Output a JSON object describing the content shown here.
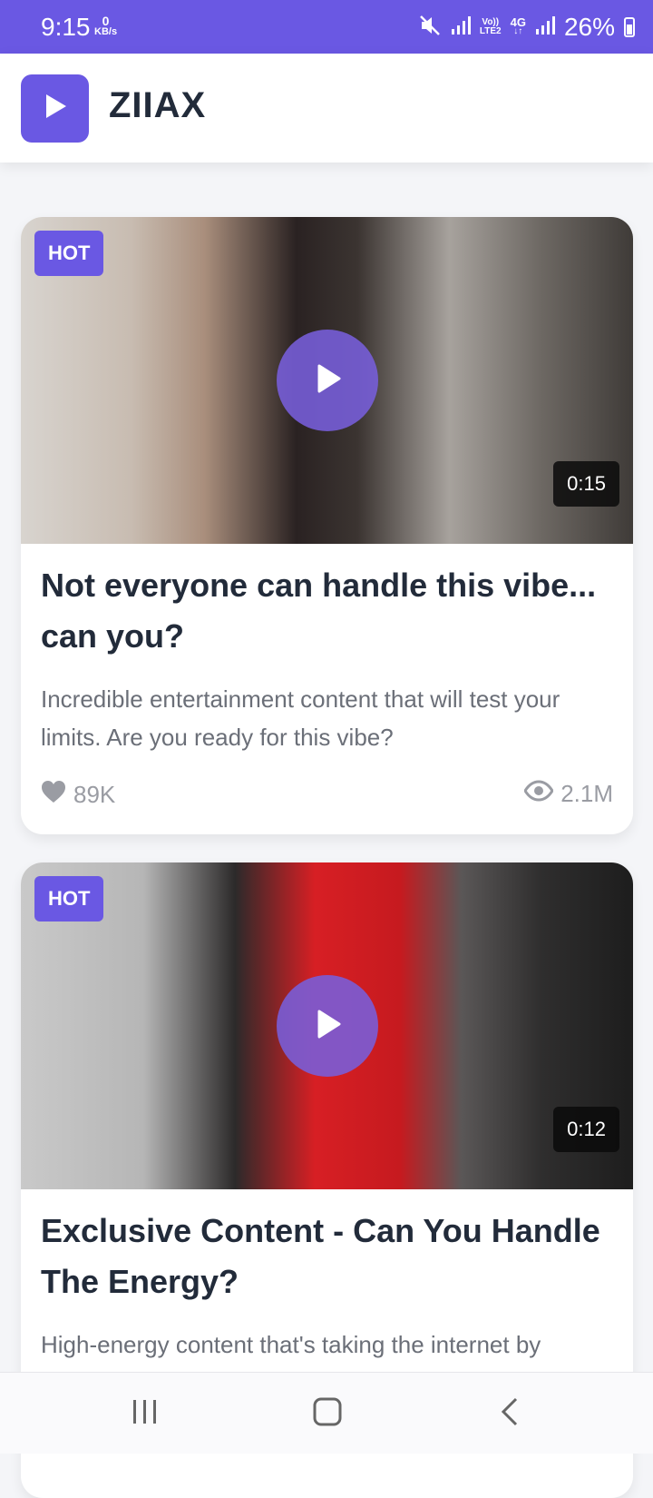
{
  "status_bar": {
    "time": "9:15",
    "kbs_value": "0",
    "kbs_unit": "KB/s",
    "network_label_top": "Vo))",
    "network_label_bottom": "LTE2",
    "network_type": "4G",
    "battery": "26%"
  },
  "header": {
    "title": "ZIIAX",
    "logo_icon": "play-icon",
    "accent_color": "#6a58e3"
  },
  "cards": [
    {
      "badge": "HOT",
      "duration": "0:15",
      "title": "Not everyone can handle this vibe... can you?",
      "description": "Incredible entertainment content that will test your limits. Are you ready for this vibe?",
      "likes": "89K",
      "views": "2.1M"
    },
    {
      "badge": "HOT",
      "duration": "0:12",
      "title": "Exclusive Content - Can You Handle The Energy?",
      "description": "High-energy content that's taking the internet by",
      "likes": "",
      "views": ""
    }
  ],
  "nav": {
    "recents_icon": "recents-icon",
    "home_icon": "home-icon",
    "back_icon": "back-icon"
  }
}
